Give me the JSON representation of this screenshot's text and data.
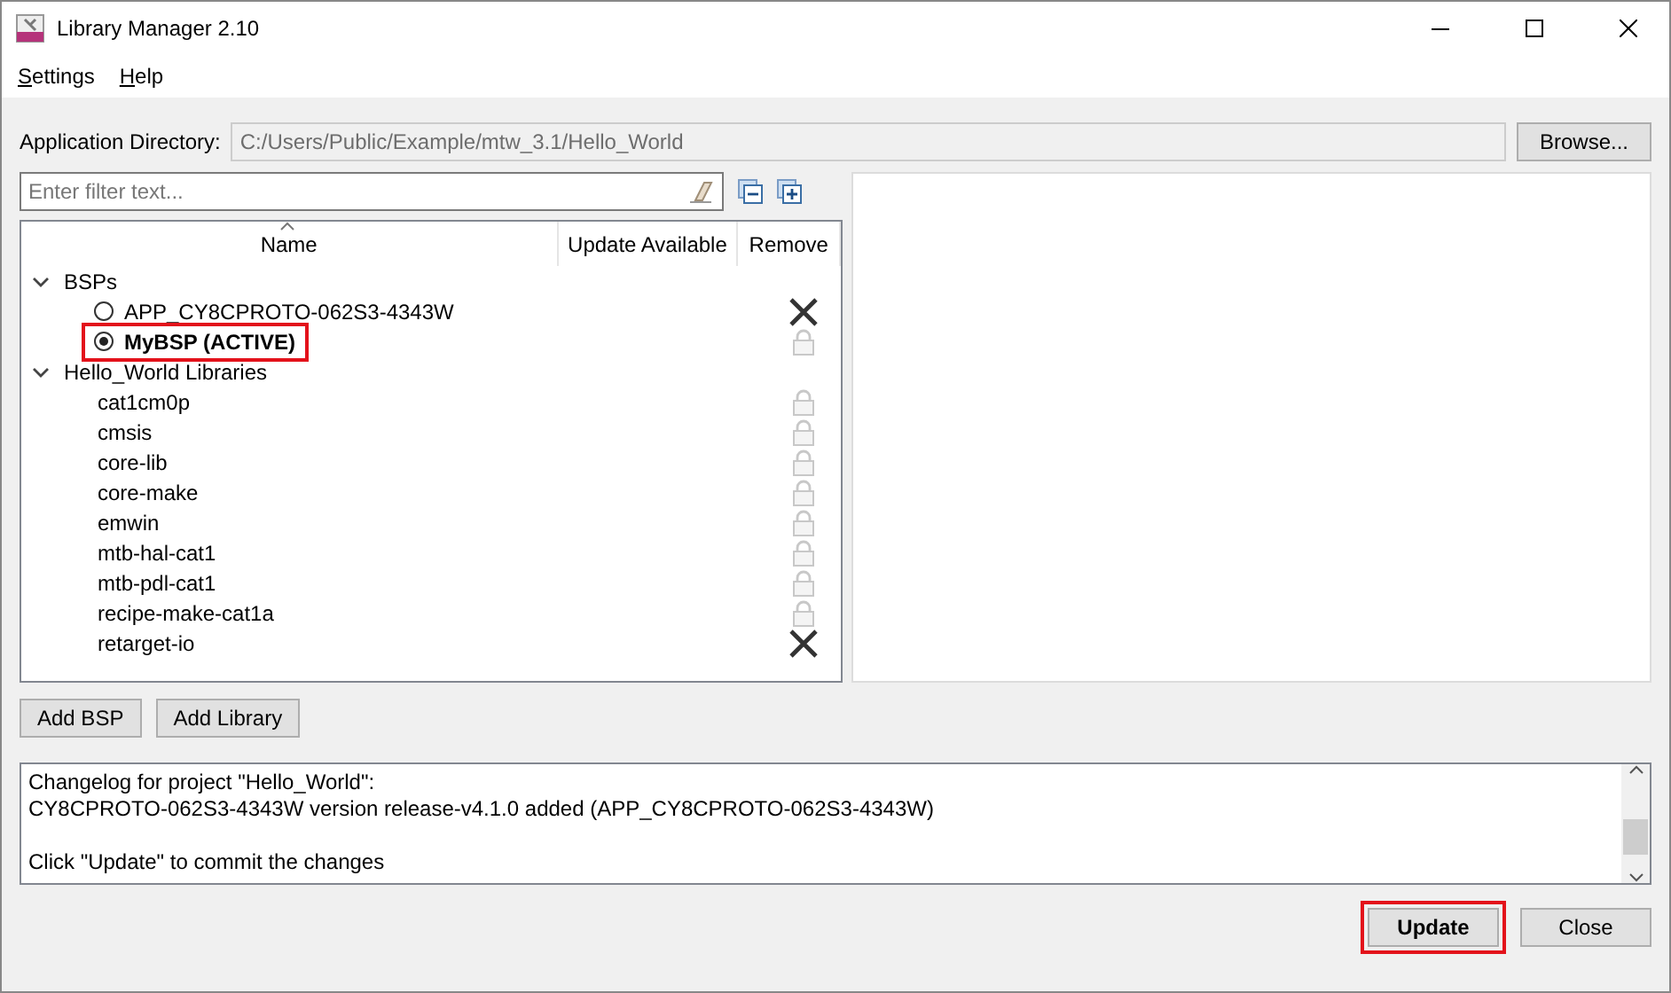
{
  "window": {
    "title": "Library Manager 2.10"
  },
  "menu": [
    {
      "label": "Settings"
    },
    {
      "label": "Help"
    }
  ],
  "app_directory": {
    "label": "Application Directory:",
    "value": "C:/Users/Public/Example/mtw_3.1/Hello_World",
    "browse": "Browse..."
  },
  "filter": {
    "placeholder": "Enter filter text..."
  },
  "tree": {
    "columns": [
      "Name",
      "Update Available",
      "Remove"
    ],
    "groups": [
      {
        "label": "BSPs",
        "expanded": true,
        "children": [
          {
            "kind": "bsp",
            "name": "APP_CY8CPROTO-062S3-4343W",
            "selected": false,
            "highlighted": false,
            "removable": true
          },
          {
            "kind": "bsp",
            "name": "MyBSP (ACTIVE)",
            "selected": true,
            "highlighted": true,
            "removable": false
          }
        ]
      },
      {
        "label": "Hello_World Libraries",
        "expanded": true,
        "children": [
          {
            "kind": "library",
            "name": "cat1cm0p",
            "removable": false
          },
          {
            "kind": "library",
            "name": "cmsis",
            "removable": false
          },
          {
            "kind": "library",
            "name": "core-lib",
            "removable": false
          },
          {
            "kind": "library",
            "name": "core-make",
            "removable": false
          },
          {
            "kind": "library",
            "name": "emwin",
            "removable": false
          },
          {
            "kind": "library",
            "name": "mtb-hal-cat1",
            "removable": false
          },
          {
            "kind": "library",
            "name": "mtb-pdl-cat1",
            "removable": false
          },
          {
            "kind": "library",
            "name": "recipe-make-cat1a",
            "removable": false
          },
          {
            "kind": "library",
            "name": "retarget-io",
            "removable": true
          }
        ]
      }
    ]
  },
  "add_buttons": [
    "Add BSP",
    "Add Library"
  ],
  "changelog": {
    "lines": [
      "Changelog for project \"Hello_World\":",
      "CY8CPROTO-062S3-4343W version release-v4.1.0 added (APP_CY8CPROTO-062S3-4343W)"
    ],
    "note": "Click \"Update\" to commit the changes"
  },
  "buttons": [
    {
      "label": "Update",
      "highlighted": true,
      "bold": true
    },
    {
      "label": "Close",
      "highlighted": false,
      "bold": false
    }
  ]
}
